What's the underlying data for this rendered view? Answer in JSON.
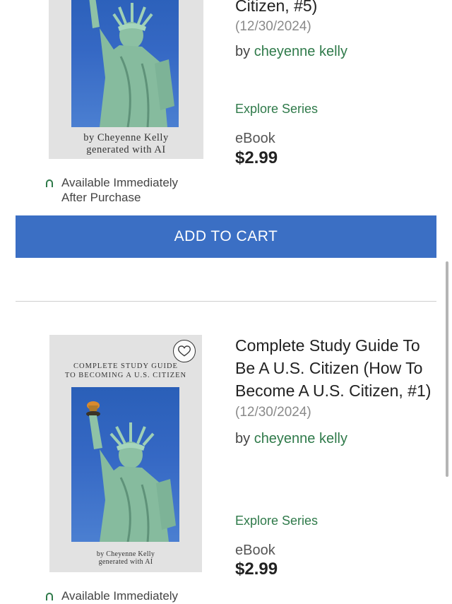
{
  "items": [
    {
      "title": "Citizen, #5)",
      "date": "(12/30/2024)",
      "by_label": "by",
      "author": "cheyenne kelly",
      "explore": "Explore Series",
      "format": "eBook",
      "price": "$2.99",
      "availability": "Available Immediately After Purchase",
      "cover": {
        "title_lines": [],
        "author_line1": "by Cheyenne Kelly",
        "author_line2": "generated with AI"
      }
    },
    {
      "title": "Complete Study Guide To Be A U.S. Citizen (How To Become A U.S. Citizen, #1)",
      "date": "(12/30/2024)",
      "by_label": "by",
      "author": "cheyenne kelly",
      "explore": "Explore Series",
      "format": "eBook",
      "price": "$2.99",
      "availability": "Available Immediately",
      "cover": {
        "title_line1": "COMPLETE STUDY GUIDE",
        "title_line2": "TO BECOMING A U.S. CITIZEN",
        "author_line1": "by Cheyenne Kelly",
        "author_line2": "generated with AI"
      }
    }
  ],
  "add_to_cart": "ADD TO CART",
  "icons": {
    "wishlist": "heart-outline-icon",
    "availability": "availability-arc-icon"
  },
  "colors": {
    "accent_button": "#3b6fc4",
    "link_green": "#2f7a4a"
  }
}
